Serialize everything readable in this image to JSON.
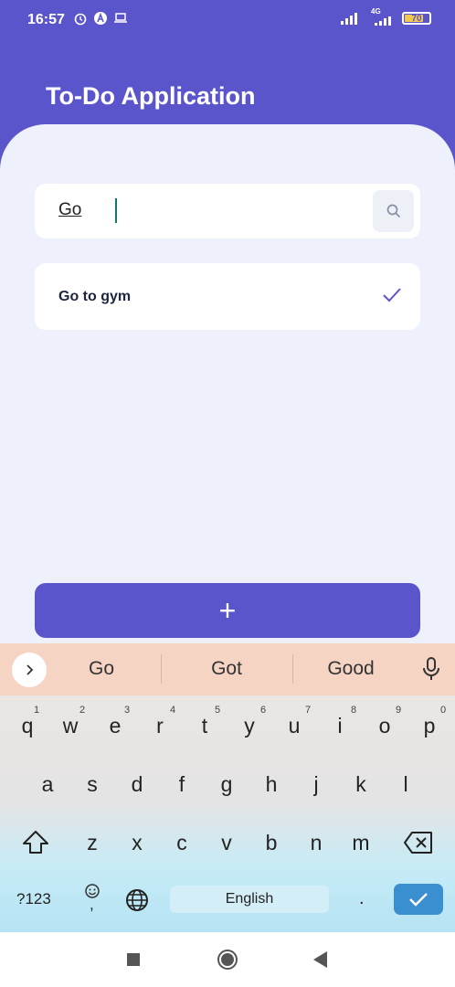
{
  "status_bar": {
    "time": "16:57",
    "network": "4G",
    "battery": "70",
    "left_icons": [
      "alarm-icon",
      "app-a-icon",
      "laptop-icon"
    ],
    "right_icons": [
      "signal-icon",
      "signal-4g-icon",
      "battery-icon"
    ]
  },
  "app": {
    "title": "To-Do Application",
    "accent_color": "#5b55cc"
  },
  "search": {
    "value": "Go",
    "icon": "search-icon"
  },
  "todos": [
    {
      "text": "Go to gym",
      "done_icon": "checkmark-icon"
    }
  ],
  "add_button": {
    "label": "+"
  },
  "keyboard": {
    "suggestions": [
      "Go",
      "Got",
      "Good"
    ],
    "row1": [
      "q",
      "w",
      "e",
      "r",
      "t",
      "y",
      "u",
      "i",
      "o",
      "p"
    ],
    "row1_numbers": [
      "1",
      "2",
      "3",
      "4",
      "5",
      "6",
      "7",
      "8",
      "9",
      "0"
    ],
    "row2": [
      "a",
      "s",
      "d",
      "f",
      "g",
      "h",
      "j",
      "k",
      "l"
    ],
    "row3": [
      "z",
      "x",
      "c",
      "v",
      "b",
      "n",
      "m"
    ],
    "symbols_label": "?123",
    "space_label": "English",
    "period_label": ".",
    "comma_label": ","
  },
  "nav_icons": [
    "recents-icon",
    "home-icon",
    "back-icon"
  ]
}
